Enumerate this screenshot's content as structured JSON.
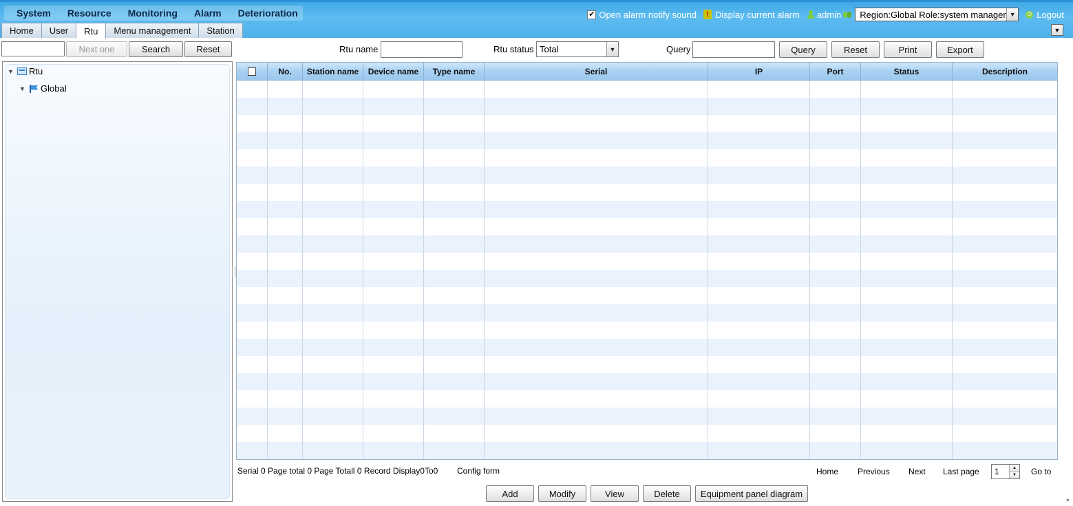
{
  "main_menu": [
    "System",
    "Resource",
    "Monitoring",
    "Alarm",
    "Deterioration"
  ],
  "top_right": {
    "alarm_sound_label": "Open alarm notify sound",
    "alarm_sound_checked": true,
    "display_alarm_label": "Display current alarm",
    "user": "admin",
    "region_role": "Region:Global Role:system manager",
    "logout": "Logout"
  },
  "tabs": [
    "Home",
    "User",
    "Rtu",
    "Menu management",
    "Station"
  ],
  "active_tab": "Rtu",
  "left": {
    "search_value": "",
    "next_one": "Next one",
    "search": "Search",
    "reset": "Reset",
    "tree": {
      "root": "Rtu",
      "child": "Global"
    }
  },
  "query": {
    "rtu_name_label": "Rtu name",
    "rtu_name_value": "",
    "rtu_status_label": "Rtu status",
    "rtu_status_value": "Total",
    "query_label": "Query",
    "query_value": "",
    "query_btn": "Query",
    "reset_btn": "Reset",
    "print_btn": "Print",
    "export_btn": "Export"
  },
  "grid": {
    "columns": [
      "",
      "No.",
      "Station name",
      "Device name",
      "Type name",
      "Serial",
      "IP",
      "Port",
      "Status",
      "Description"
    ],
    "rows": []
  },
  "pager": {
    "info": "Serial 0 Page total 0 Page Totall 0 Record Display0To0",
    "config_form": "Config form",
    "home": "Home",
    "previous": "Previous",
    "next": "Next",
    "last_page": "Last page",
    "page_value": "1",
    "go_to": "Go to"
  },
  "actions": [
    "Add",
    "Modify",
    "View",
    "Delete",
    "Equipment panel diagram"
  ]
}
